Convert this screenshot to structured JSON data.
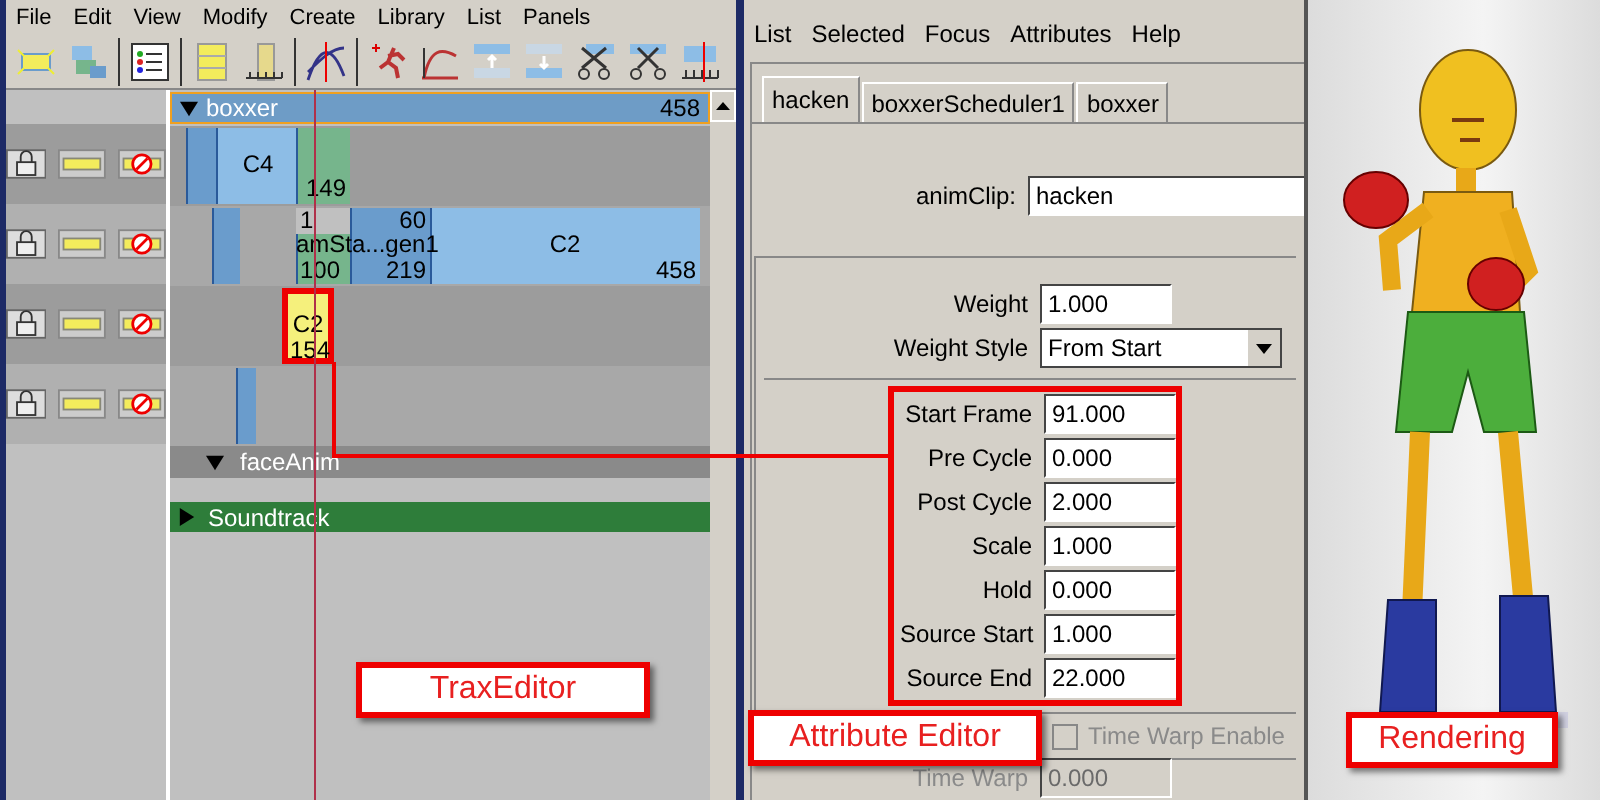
{
  "trax_editor": {
    "menu": [
      "File",
      "Edit",
      "View",
      "Modify",
      "Create",
      "Library",
      "List",
      "Panels"
    ],
    "character": {
      "name": "boxxer",
      "end_frame": "458",
      "expanded": true,
      "selected": true
    },
    "tracks": [
      {
        "clips": [
          {
            "color": "#6a9ccc",
            "highlighted": false
          },
          {
            "color": "#8dbde6",
            "highlighted": false,
            "texts": [
              "C4"
            ]
          },
          {
            "color": "#76b58c",
            "highlighted": false,
            "texts": [
              "149"
            ]
          }
        ]
      },
      {
        "caption": "amSta...gen1",
        "clips": [
          {
            "color": "#6a9ccc",
            "highlighted": false
          },
          {
            "color": "#76b58c",
            "highlighted": false,
            "texts": [
              "1",
              "100"
            ]
          },
          {
            "color": "#6a9ccc",
            "highlighted": false,
            "texts": [
              "60",
              "219"
            ]
          },
          {
            "color": "#8dbde6",
            "highlighted": false,
            "texts": [
              "C2",
              "458"
            ]
          }
        ]
      },
      {
        "clips": [
          {
            "color": "#f5f07c",
            "highlighted": true,
            "texts": [
              "C2",
              "154"
            ]
          }
        ]
      },
      {
        "clips": [
          {
            "color": "#6a9ccc",
            "highlighted": false
          }
        ]
      }
    ],
    "sub_character": {
      "name": "faceAnim",
      "expanded": true
    },
    "soundtrack": {
      "name": "Soundtrack",
      "expanded": false
    },
    "callout": "TraxEditor"
  },
  "attribute_editor": {
    "menu": [
      "List",
      "Selected",
      "Focus",
      "Attributes",
      "Help"
    ],
    "tabs": [
      {
        "label": "hacken",
        "selected": true
      },
      {
        "label": "boxxerScheduler1",
        "selected": false
      },
      {
        "label": "boxxer",
        "selected": false
      }
    ],
    "anim_clip": {
      "label": "animClip:",
      "value": "hacken"
    },
    "fields": [
      {
        "kind": "number",
        "label": "Weight",
        "value": "1.000"
      },
      {
        "kind": "dropdown",
        "label": "Weight Style",
        "value": "From Start"
      }
    ],
    "clip_fields": {
      "highlighted": true,
      "items": [
        {
          "label": "Start Frame",
          "value": "91.000"
        },
        {
          "label": "Pre Cycle",
          "value": "0.000"
        },
        {
          "label": "Post Cycle",
          "value": "2.000"
        },
        {
          "label": "Scale",
          "value": "1.000"
        },
        {
          "label": "Hold",
          "value": "0.000"
        },
        {
          "label": "Source Start",
          "value": "1.000"
        },
        {
          "label": "Source End",
          "value": "22.000"
        }
      ]
    },
    "time_warp_enable": {
      "label": "Time Warp Enable",
      "checked": false,
      "disabled": true
    },
    "time_warp": {
      "label": "Time Warp",
      "value": "0.000",
      "disabled": true
    },
    "callout": "Attribute Editor"
  },
  "rendering": {
    "callout": "Rendering"
  }
}
